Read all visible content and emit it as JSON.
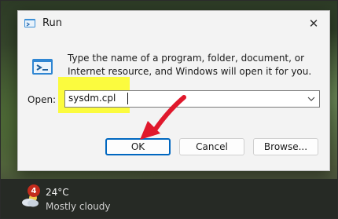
{
  "window": {
    "title": "Run",
    "icon": "run-icon",
    "close_glyph": "✕"
  },
  "dialog": {
    "description": "Type the name of a program, folder, document, or Internet resource, and Windows will open it for you.",
    "open_label": "Open:",
    "open_value": "sysdm.cpl",
    "buttons": {
      "ok": "OK",
      "cancel": "Cancel",
      "browse": "Browse..."
    }
  },
  "taskbar": {
    "weather_icon": "partly-cloudy-icon",
    "notification_count": "4",
    "temperature": "24°C",
    "condition": "Mostly cloudy"
  },
  "colors": {
    "highlight": "#fbfb3e",
    "accent": "#0067c0",
    "annotation_arrow": "#e0182c",
    "badge": "#c42b1c"
  }
}
